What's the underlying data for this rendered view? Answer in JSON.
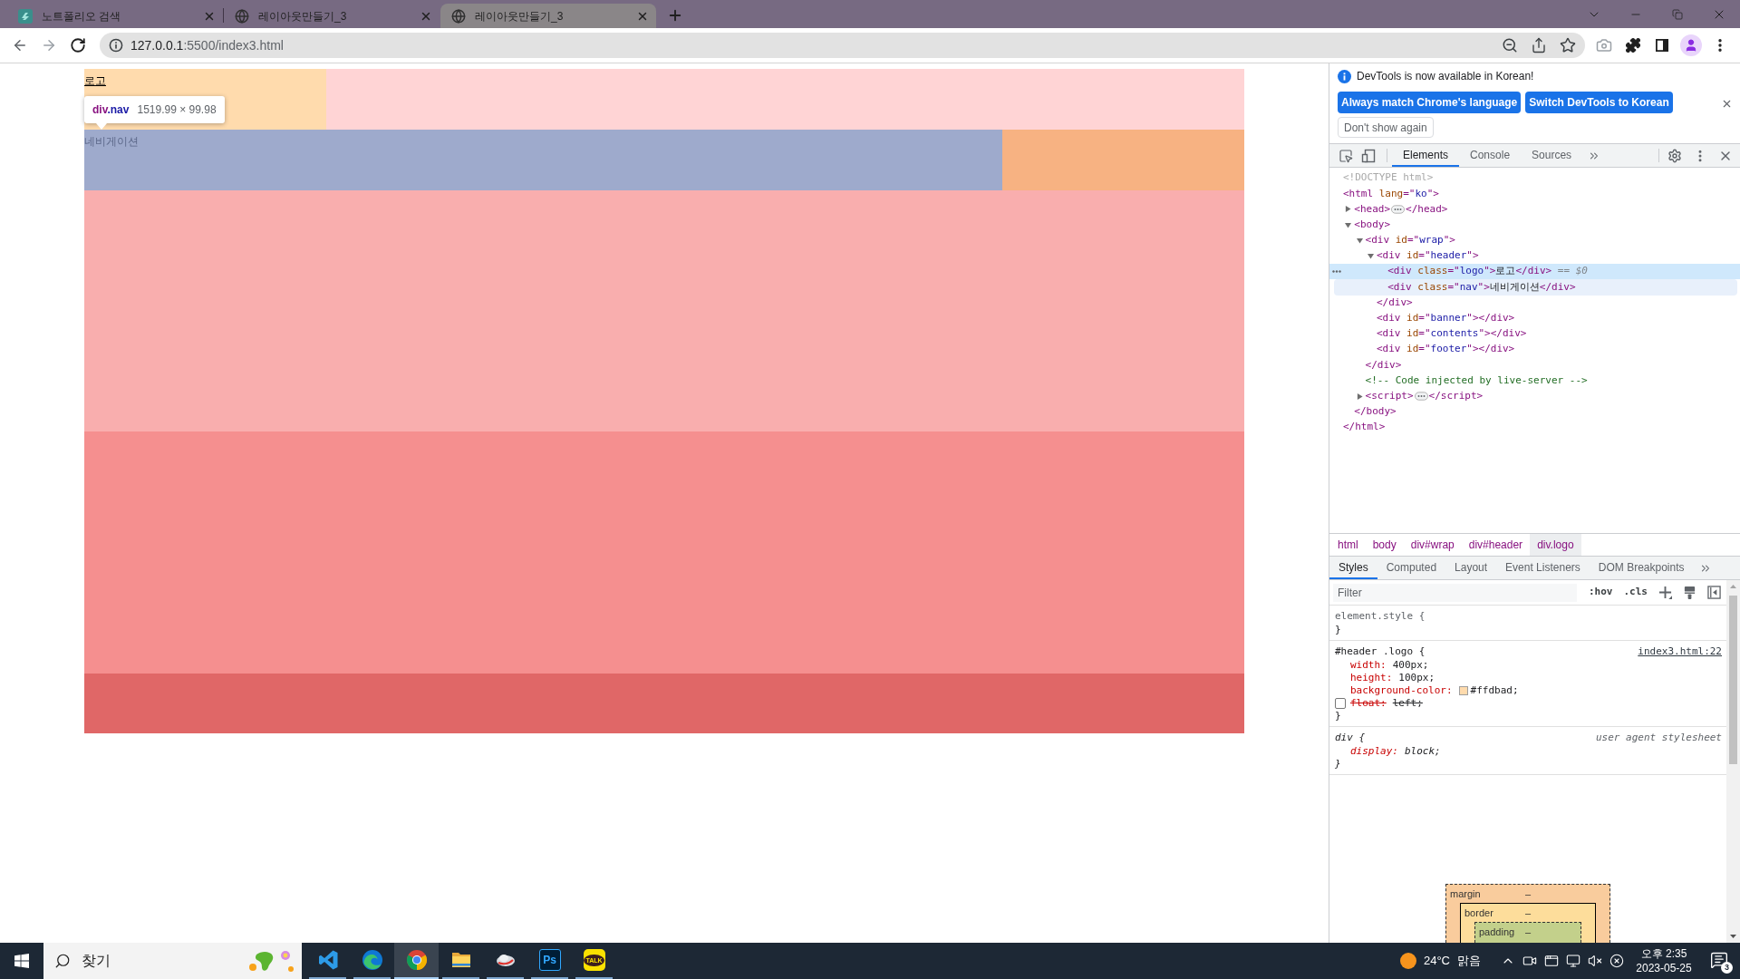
{
  "browser": {
    "tabs": [
      {
        "title": "노트폴리오 검색",
        "kind": "site",
        "selected": false
      },
      {
        "title": "레이아웃만들기_3",
        "kind": "globe",
        "selected": false
      },
      {
        "title": "레이아웃만들기_3",
        "kind": "globe",
        "selected": true
      }
    ],
    "url": {
      "host": "127.0.0.1",
      "path": ":5500/index3.html"
    }
  },
  "page": {
    "logo_text": "로고",
    "nav_text": "네비게이션",
    "inspect_tooltip": {
      "tag": "div",
      "class": ".nav",
      "size": "1519.99 × 99.98"
    }
  },
  "devtools": {
    "notice": {
      "message": "DevTools is now available in Korean!",
      "buttons": [
        {
          "label": "Always match Chrome's language",
          "kind": "primary"
        },
        {
          "label": "Switch DevTools to Korean",
          "kind": "primary"
        },
        {
          "label": "Don't show again",
          "kind": "secondary"
        }
      ]
    },
    "panel_tabs": [
      {
        "label": "Elements",
        "selected": true
      },
      {
        "label": "Console",
        "selected": false
      },
      {
        "label": "Sources",
        "selected": false
      }
    ],
    "dom_tree": [
      {
        "segments": [
          {
            "kind": "doctype",
            "text": "<!DOCTYPE html>"
          }
        ],
        "selected": false,
        "hovered": false
      },
      {
        "segments": [
          {
            "kind": "tag",
            "text": "<html"
          },
          {
            "kind": "attr_name",
            "text": " lang"
          },
          {
            "kind": "tag",
            "text": "=\""
          },
          {
            "kind": "attr_value",
            "text": "ko"
          },
          {
            "kind": "tag",
            "text": "\">"
          }
        ],
        "selected": false,
        "hovered": false,
        "children": [
          {
            "segments": [
              {
                "kind": "tag",
                "text": "<head>"
              },
              {
                "kind": "collapsed"
              },
              {
                "kind": "tag",
                "text": "</head>"
              }
            ],
            "expanded": false,
            "selected": false,
            "hovered": false
          },
          {
            "segments": [
              {
                "kind": "tag",
                "text": "<body>"
              }
            ],
            "expanded": true,
            "selected": false,
            "hovered": false,
            "children": [
              {
                "segments": [
                  {
                    "kind": "tag",
                    "text": "<div"
                  },
                  {
                    "kind": "attr_name",
                    "text": " id"
                  },
                  {
                    "kind": "tag",
                    "text": "=\""
                  },
                  {
                    "kind": "attr_value",
                    "text": "wrap"
                  },
                  {
                    "kind": "tag",
                    "text": "\">"
                  }
                ],
                "expanded": true,
                "selected": false,
                "hovered": false,
                "children": [
                  {
                    "segments": [
                      {
                        "kind": "tag",
                        "text": "<div"
                      },
                      {
                        "kind": "attr_name",
                        "text": " id"
                      },
                      {
                        "kind": "tag",
                        "text": "=\""
                      },
                      {
                        "kind": "attr_value",
                        "text": "header"
                      },
                      {
                        "kind": "tag",
                        "text": "\">"
                      }
                    ],
                    "expanded": true,
                    "selected": false,
                    "hovered": false,
                    "children": [
                      {
                        "segments": [
                          {
                            "kind": "tag",
                            "text": "<div"
                          },
                          {
                            "kind": "attr_name",
                            "text": " class"
                          },
                          {
                            "kind": "tag",
                            "text": "=\""
                          },
                          {
                            "kind": "attr_value",
                            "text": "logo"
                          },
                          {
                            "kind": "tag",
                            "text": "\">"
                          },
                          {
                            "kind": "text",
                            "text": "로고"
                          },
                          {
                            "kind": "tag",
                            "text": "</div>"
                          },
                          {
                            "kind": "marker",
                            "text": " == $0"
                          }
                        ],
                        "selected": true,
                        "hovered": false
                      },
                      {
                        "segments": [
                          {
                            "kind": "tag",
                            "text": "<div"
                          },
                          {
                            "kind": "attr_name",
                            "text": " class"
                          },
                          {
                            "kind": "tag",
                            "text": "=\""
                          },
                          {
                            "kind": "attr_value",
                            "text": "nav"
                          },
                          {
                            "kind": "tag",
                            "text": "\">"
                          },
                          {
                            "kind": "text",
                            "text": "네비게이션"
                          },
                          {
                            "kind": "tag",
                            "text": "</div>"
                          }
                        ],
                        "selected": false,
                        "hovered": true
                      }
                    ],
                    "closing": [
                      {
                        "kind": "tag",
                        "text": "</div>"
                      }
                    ]
                  },
                  {
                    "segments": [
                      {
                        "kind": "tag",
                        "text": "<div"
                      },
                      {
                        "kind": "attr_name",
                        "text": " id"
                      },
                      {
                        "kind": "tag",
                        "text": "=\""
                      },
                      {
                        "kind": "attr_value",
                        "text": "banner"
                      },
                      {
                        "kind": "tag",
                        "text": "\"></div>"
                      }
                    ],
                    "selected": false,
                    "hovered": false
                  },
                  {
                    "segments": [
                      {
                        "kind": "tag",
                        "text": "<div"
                      },
                      {
                        "kind": "attr_name",
                        "text": " id"
                      },
                      {
                        "kind": "tag",
                        "text": "=\""
                      },
                      {
                        "kind": "attr_value",
                        "text": "contents"
                      },
                      {
                        "kind": "tag",
                        "text": "\"></div>"
                      }
                    ],
                    "selected": false,
                    "hovered": false
                  },
                  {
                    "segments": [
                      {
                        "kind": "tag",
                        "text": "<div"
                      },
                      {
                        "kind": "attr_name",
                        "text": " id"
                      },
                      {
                        "kind": "tag",
                        "text": "=\""
                      },
                      {
                        "kind": "attr_value",
                        "text": "footer"
                      },
                      {
                        "kind": "tag",
                        "text": "\"></div>"
                      }
                    ],
                    "selected": false,
                    "hovered": false
                  }
                ],
                "closing": [
                  {
                    "kind": "tag",
                    "text": "</div>"
                  }
                ]
              },
              {
                "segments": [
                  {
                    "kind": "comment",
                    "text": "<!-- Code injected by live-server -->"
                  }
                ],
                "selected": false,
                "hovered": false
              },
              {
                "segments": [
                  {
                    "kind": "tag",
                    "text": "<script>"
                  },
                  {
                    "kind": "collapsed"
                  },
                  {
                    "kind": "tag",
                    "text": "</script>"
                  }
                ],
                "expanded": false,
                "selected": false,
                "hovered": false
              }
            ],
            "closing": [
              {
                "kind": "tag",
                "text": "</body>"
              }
            ]
          }
        ],
        "closing": [
          {
            "kind": "tag",
            "text": "</html>"
          }
        ]
      }
    ],
    "breadcrumbs": [
      {
        "label": "html",
        "selected": false
      },
      {
        "label": "body",
        "selected": false
      },
      {
        "label": "div#wrap",
        "selected": false
      },
      {
        "label": "div#header",
        "selected": false
      },
      {
        "label": "div.logo",
        "selected": true
      }
    ],
    "sidebar_tabs": [
      {
        "label": "Styles",
        "selected": true
      },
      {
        "label": "Computed",
        "selected": false
      },
      {
        "label": "Layout",
        "selected": false
      },
      {
        "label": "Event Listeners",
        "selected": false
      },
      {
        "label": "DOM Breakpoints",
        "selected": false
      }
    ],
    "filter": {
      "placeholder": "Filter",
      "toggles": [
        ":hov",
        ".cls"
      ]
    },
    "rules": [
      {
        "kind": "inline",
        "selector": "element.style {",
        "close": "}"
      },
      {
        "kind": "author",
        "selector": "#header .logo {",
        "source": "index3.html:22",
        "declarations": [
          {
            "name": "width:",
            "value": "400px;",
            "enabled": true
          },
          {
            "name": "height:",
            "value": "100px;",
            "enabled": true
          },
          {
            "name": "background-color:",
            "value": "#ffdbad;",
            "color": "#ffdbad",
            "enabled": true
          },
          {
            "name": "float:",
            "value": "left;",
            "enabled": false
          }
        ],
        "close": "}"
      },
      {
        "kind": "user_agent",
        "selector": "div {",
        "source": "user agent stylesheet",
        "declarations": [
          {
            "name": "display:",
            "value": "block;",
            "enabled": true
          }
        ],
        "close": "}"
      }
    ],
    "box_model": [
      {
        "label": "margin",
        "value": "–"
      },
      {
        "label": "border",
        "value": "–"
      },
      {
        "label": "padding",
        "value": "–"
      }
    ]
  },
  "taskbar": {
    "search": {
      "placeholder": "찾기"
    },
    "apps": [
      {
        "kind": "code_editor",
        "selected": false
      },
      {
        "kind": "edge",
        "selected": false
      },
      {
        "kind": "chrome",
        "selected": true
      },
      {
        "kind": "file_explorer",
        "selected": false
      },
      {
        "kind": "cloud_app",
        "selected": false
      },
      {
        "kind": "photoshop",
        "label": "Ps",
        "selected": false
      },
      {
        "kind": "kakaotalk",
        "label": "TALK",
        "selected": false
      }
    ],
    "weather": {
      "temperature": "24°C",
      "condition": "맑음"
    },
    "clock": {
      "time": "오후 2:35",
      "date": "2023-05-25"
    },
    "notification_count": "3"
  }
}
